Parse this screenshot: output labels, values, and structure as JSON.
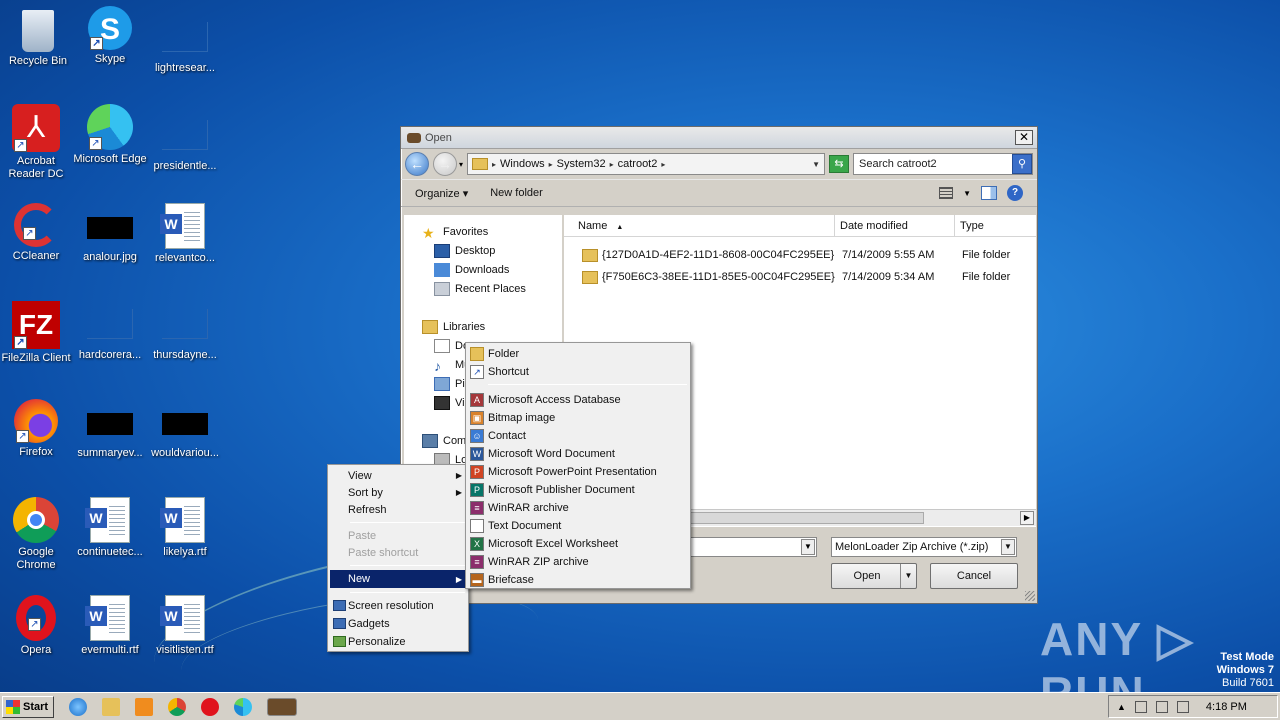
{
  "desktop": {
    "icons": [
      {
        "label": "Recycle Bin"
      },
      {
        "label": "Skype"
      },
      {
        "label": "lightresear..."
      },
      {
        "label": "Acrobat Reader DC"
      },
      {
        "label": "Microsoft Edge"
      },
      {
        "label": "presidentle..."
      },
      {
        "label": "CCleaner"
      },
      {
        "label": "analour.jpg"
      },
      {
        "label": "relevantco..."
      },
      {
        "label": "FileZilla Client"
      },
      {
        "label": "hardcorera..."
      },
      {
        "label": "thursdayne..."
      },
      {
        "label": "Firefox"
      },
      {
        "label": "summaryev..."
      },
      {
        "label": "wouldvariou..."
      },
      {
        "label": "Google Chrome"
      },
      {
        "label": "continuetec..."
      },
      {
        "label": "likelya.rtf"
      },
      {
        "label": "Opera"
      },
      {
        "label": "evermulti.rtf"
      },
      {
        "label": "visitlisten.rtf"
      }
    ]
  },
  "dialog": {
    "title": "Open",
    "close_label": "✕",
    "breadcrumbs": [
      "Windows",
      "System32",
      "catroot2"
    ],
    "search_placeholder": "Search catroot2",
    "toolbar": {
      "organize": "Organize ▾",
      "new_folder": "New folder"
    },
    "nav": {
      "favorites": "Favorites",
      "desktop": "Desktop",
      "downloads": "Downloads",
      "recent": "Recent Places",
      "libraries": "Libraries",
      "lib_docs": "Do",
      "lib_music": "Mu",
      "lib_pics": "Pic",
      "lib_vids": "Vic",
      "computer": "Com",
      "local": "Lo"
    },
    "columns": {
      "name": "Name",
      "date": "Date modified",
      "type": "Type"
    },
    "files": [
      {
        "name": "{127D0A1D-4EF2-11D1-8608-00C04FC295EE}",
        "date": "7/14/2009 5:55 AM",
        "type": "File folder"
      },
      {
        "name": "{F750E6C3-38EE-11D1-85E5-00C04FC295EE}",
        "date": "7/14/2009 5:34 AM",
        "type": "File folder"
      }
    ],
    "file_type": "MelonLoader Zip Archive (*.zip)",
    "open_label": "Open",
    "cancel_label": "Cancel"
  },
  "context_menu": {
    "view": "View",
    "sort_by": "Sort by",
    "refresh": "Refresh",
    "paste": "Paste",
    "paste_shortcut": "Paste shortcut",
    "new": "New",
    "screen_resolution": "Screen resolution",
    "gadgets": "Gadgets",
    "personalize": "Personalize"
  },
  "new_submenu": {
    "folder": "Folder",
    "shortcut": "Shortcut",
    "items": [
      {
        "label": "Microsoft Access Database",
        "color": "#a4373a",
        "glyph": "A"
      },
      {
        "label": "Bitmap image",
        "color": "#d9822b",
        "glyph": "▣"
      },
      {
        "label": "Contact",
        "color": "#3a7bd5",
        "glyph": "☺"
      },
      {
        "label": "Microsoft Word Document",
        "color": "#2b579a",
        "glyph": "W"
      },
      {
        "label": "Microsoft PowerPoint Presentation",
        "color": "#d04423",
        "glyph": "P"
      },
      {
        "label": "Microsoft Publisher Document",
        "color": "#077568",
        "glyph": "P"
      },
      {
        "label": "WinRAR archive",
        "color": "#8b2d6b",
        "glyph": "≡"
      },
      {
        "label": "Text Document",
        "color": "#ffffff",
        "glyph": ""
      },
      {
        "label": "Microsoft Excel Worksheet",
        "color": "#217346",
        "glyph": "X"
      },
      {
        "label": "WinRAR ZIP archive",
        "color": "#8b2d6b",
        "glyph": "≡"
      },
      {
        "label": "Briefcase",
        "color": "#b5651d",
        "glyph": "▬"
      }
    ]
  },
  "taskbar": {
    "start_label": "Start",
    "clock": "4:18 PM"
  },
  "watermark": {
    "line1": "Test Mode",
    "line2": "Windows 7",
    "line3": "Build 7601",
    "brand": "ANY ▷ RUN"
  }
}
